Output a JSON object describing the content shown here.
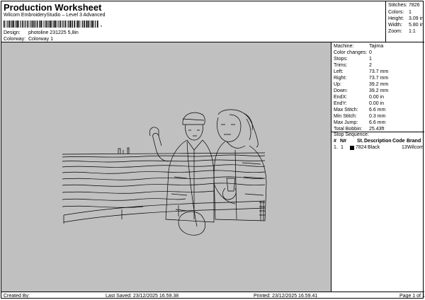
{
  "header": {
    "title": "Production Worksheet",
    "subtitle": "Wilcom EmbroideryStudio – Level 3 Advanced",
    "barcode_text": ",",
    "design_label": "Design:",
    "design_value": "photoline 231225 5,8in",
    "colorway_label": "Colorway:",
    "colorway_value": "Colorway 1"
  },
  "summary": {
    "stitches_label": "Stitches:",
    "stitches_value": "7826",
    "colors_label": "Colors:",
    "colors_value": "1",
    "height_label": "Height:",
    "height_value": "3.09 in",
    "width_label": "Width:",
    "width_value": "5.80 in",
    "zoom_label": "Zoom:",
    "zoom_value": "1:1"
  },
  "machine": {
    "machine_label": "Machine:",
    "machine_value": "Tajima",
    "color_changes_label": "Color changes:",
    "color_changes_value": "0",
    "stops_label": "Stops:",
    "stops_value": "1",
    "trims_label": "Trims:",
    "trims_value": "2",
    "left_label": "Left:",
    "left_value": "73.7 mm",
    "right_label": "Right:",
    "right_value": "73.7 mm",
    "up_label": "Up:",
    "up_value": "39.2 mm",
    "down_label": "Down:",
    "down_value": "39.2 mm",
    "endx_label": "EndX:",
    "endx_value": "0.00 in",
    "endy_label": "EndY:",
    "endy_value": "0.00 in",
    "max_stitch_label": "Max Stitch:",
    "max_stitch_value": "6.6 mm",
    "min_stitch_label": "Min Stitch:",
    "min_stitch_value": "0.3 mm",
    "max_jump_label": "Max Jump:",
    "max_jump_value": "6.6 mm",
    "total_bobbin_label": "Total Bobbin:",
    "total_bobbin_value": "25.43ft"
  },
  "stop_sequence": {
    "title": "Stop Sequence:",
    "headers": [
      "#",
      "N#",
      "St.",
      "Description",
      "Code",
      "Brand"
    ],
    "rows": [
      {
        "num": "1.",
        "n": "1",
        "st": "7824",
        "description": "Black",
        "code": "13",
        "brand": "Wilcom",
        "color": "#000000"
      }
    ]
  },
  "footer": {
    "created_by": "Created By:",
    "last_saved": "Last Saved: 23/12/2025 16.59.38",
    "printed": "Printed: 23/12/2025 16.59.41",
    "page": "Page 1 of 1"
  },
  "colors": {
    "canvas_background": "#c0c0c0",
    "stitch_color": "#000000"
  }
}
